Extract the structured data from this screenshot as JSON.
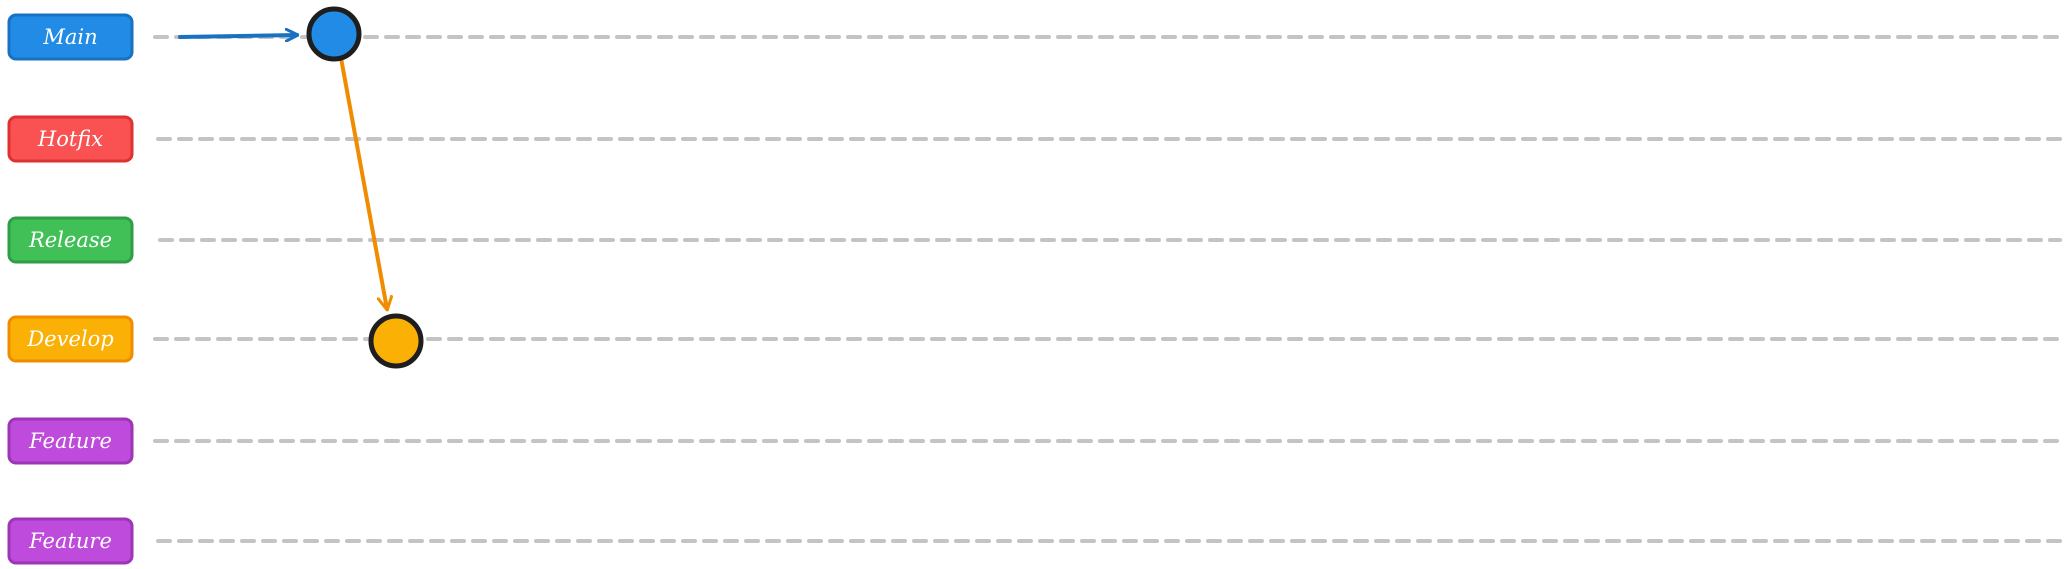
{
  "colors": {
    "main": "#228be6",
    "hotfix": "#fa5252",
    "release": "#40c057",
    "develop": "#fab005",
    "feature": "#be4bdb",
    "lane_line": "#c4c4c4",
    "outline": "#1e1e1e",
    "arrow_main": "#1971c2",
    "arrow_develop": "#f08c00"
  },
  "branches": [
    {
      "id": "main",
      "label": "Main",
      "color": "#228be6",
      "border": "#1971c2"
    },
    {
      "id": "hotfix",
      "label": "Hotfix",
      "color": "#fa5252",
      "border": "#e03131"
    },
    {
      "id": "release",
      "label": "Release",
      "color": "#40c057",
      "border": "#2f9e44"
    },
    {
      "id": "develop",
      "label": "Develop",
      "color": "#fab005",
      "border": "#f08c00"
    },
    {
      "id": "feature-1",
      "label": "Feature",
      "color": "#be4bdb",
      "border": "#9c36b5"
    },
    {
      "id": "feature-2",
      "label": "Feature",
      "color": "#be4bdb",
      "border": "#9c36b5"
    }
  ],
  "commits": [
    {
      "id": "main-commit",
      "branch": "main",
      "color": "#228be6"
    },
    {
      "id": "develop-commit",
      "branch": "develop",
      "color": "#fab005"
    }
  ],
  "edges": [
    {
      "id": "main-entry-arrow",
      "to": "main-commit",
      "color": "#1971c2"
    },
    {
      "id": "main-to-develop-arrow",
      "from": "main-commit",
      "to": "develop-commit",
      "color": "#f08c00"
    }
  ]
}
